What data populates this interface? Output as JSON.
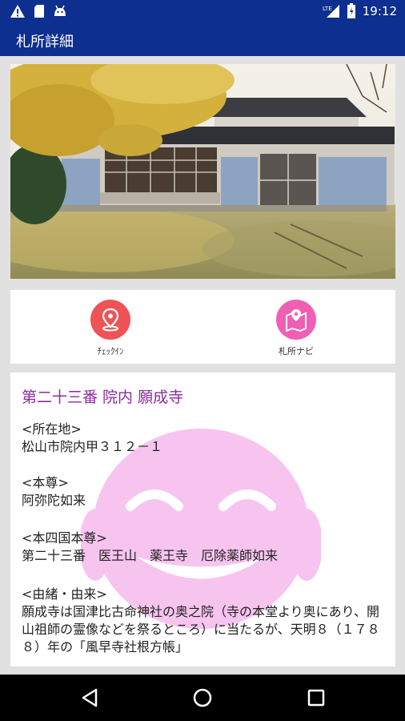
{
  "status_bar": {
    "time": "19:12",
    "network": "LTE",
    "icons": [
      "warning-icon",
      "sd-card-icon",
      "android-icon",
      "lte-signal-icon",
      "battery-icon"
    ]
  },
  "app_bar": {
    "title": "札所詳細"
  },
  "actions": {
    "checkin_label": "ﾁｪｯｸｲﾝ",
    "navi_label": "札所ナビ",
    "checkin_color": "#ef5355",
    "navi_color": "#f05fb3"
  },
  "temple": {
    "title": "第二十三番 院内 願成寺",
    "location_label": "<所在地>",
    "location_value": "松山市院内甲３１２－１",
    "deity_label": "<本尊>",
    "deity_value": "阿弥陀如来",
    "shikoku_label": "<本四国本尊>",
    "shikoku_value": "第二十三番　医王山　薬王寺　厄除薬師如来",
    "origin_label": "<由緒・由来>",
    "origin_text": "願成寺は国津比古命神社の奥之院（寺の本堂より奥にあり、開山祖師の霊像などを祭るところ）に当たるが、天明８（１７８８）年の「風早寺社根方帳」"
  },
  "colors": {
    "primary": "#0d2f8f",
    "title": "#8e2b9e",
    "watermark": "#f7c4f0"
  }
}
